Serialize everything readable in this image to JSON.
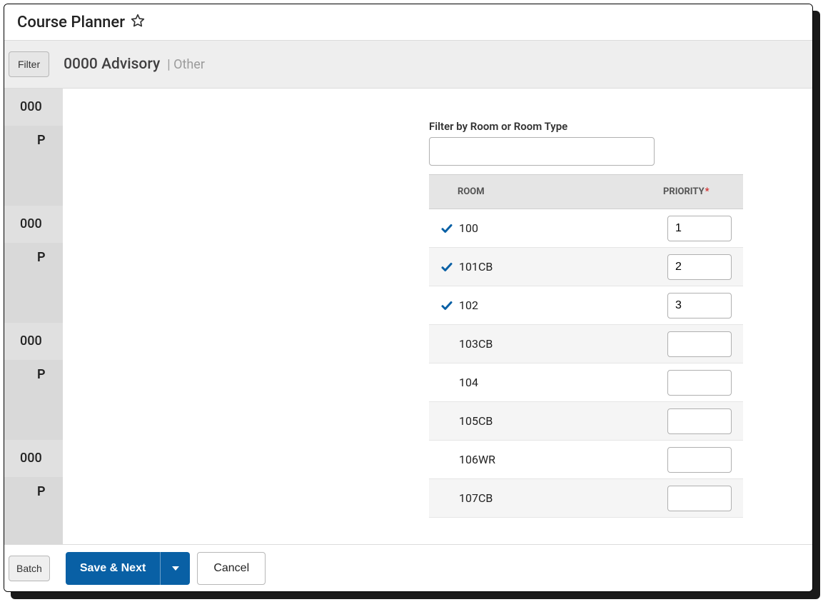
{
  "header": {
    "title": "Course Planner"
  },
  "subheader": {
    "filter_btn": "Filter",
    "title": "0000 Advisory",
    "meta": "| Other"
  },
  "left_items": [
    {
      "code": "000",
      "p": "P"
    },
    {
      "code": "000",
      "p": "P"
    },
    {
      "code": "000",
      "p": "P"
    },
    {
      "code": "000",
      "p": "P"
    }
  ],
  "filter": {
    "label": "Filter by Room or Room Type",
    "value": ""
  },
  "table": {
    "col_room": "ROOM",
    "col_priority": "PRIORITY",
    "rows": [
      {
        "room": "100",
        "priority": "1",
        "checked": true
      },
      {
        "room": "101CB",
        "priority": "2",
        "checked": true
      },
      {
        "room": "102",
        "priority": "3",
        "checked": true
      },
      {
        "room": "103CB",
        "priority": "",
        "checked": false
      },
      {
        "room": "104",
        "priority": "",
        "checked": false
      },
      {
        "room": "105CB",
        "priority": "",
        "checked": false
      },
      {
        "room": "106WR",
        "priority": "",
        "checked": false
      },
      {
        "room": "107CB",
        "priority": "",
        "checked": false
      }
    ]
  },
  "footer": {
    "batch": "Batch",
    "save_next": "Save & Next",
    "cancel": "Cancel"
  }
}
